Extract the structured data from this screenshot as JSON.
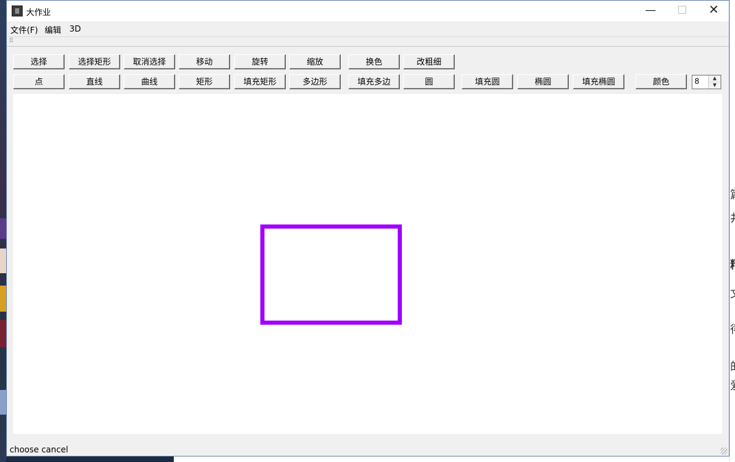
{
  "window": {
    "title": "大作业"
  },
  "menu": [
    "文件(F)",
    "编辑",
    "3D"
  ],
  "toolbar_row1": [
    "选择",
    "选择矩形",
    "取消选择",
    "移动",
    "旋转",
    "缩放",
    "换色",
    "改粗细"
  ],
  "toolbar_row2": [
    "点",
    "直线",
    "曲线",
    "矩形",
    "填充矩形",
    "多边形",
    "填充多边",
    "圆",
    "填充圆",
    "椭圆",
    "填充椭圆",
    "颜色"
  ],
  "thickness": "8",
  "canvas": {
    "shape": "rectangle",
    "stroke_color": "#a000ff"
  },
  "status": "choose cancel",
  "icons": {
    "minimize": "minimize-icon",
    "maximize": "maximize-icon",
    "close": "close-icon"
  }
}
